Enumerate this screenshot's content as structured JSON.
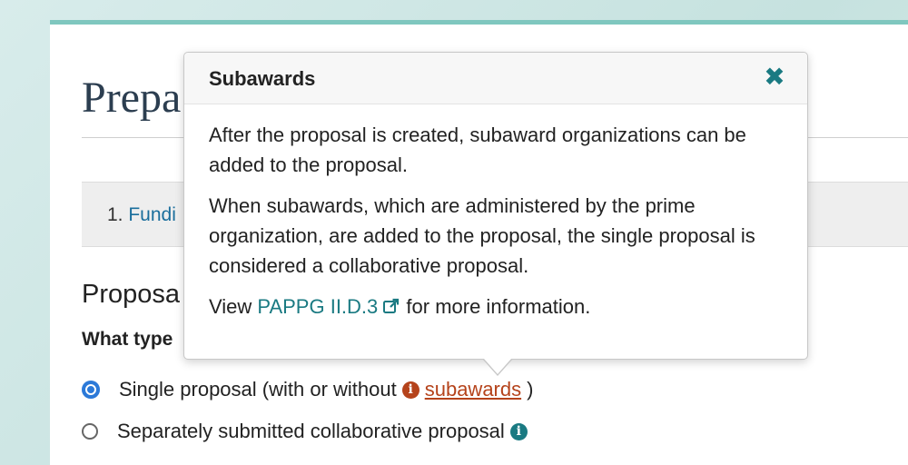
{
  "page": {
    "title": "Prepa",
    "steps": {
      "number": "1.",
      "link": "Fundi"
    },
    "section_heading": "Proposa",
    "question": "What type"
  },
  "options": {
    "single": {
      "label": "Single proposal (with or without",
      "link": "subawards",
      "close_paren": ")",
      "selected": true
    },
    "collaborative": {
      "label": "Separately submitted collaborative proposal",
      "selected": false
    }
  },
  "popover": {
    "title": "Subawards",
    "close_glyph": "✖",
    "paragraph1": "After the proposal is created, subaward organizations can be added to the proposal.",
    "paragraph2": "When subawards, which are administered by the prime organization, are added to the proposal, the single proposal is considered a collaborative proposal.",
    "view_prefix": "View",
    "link_text": "PAPPG II.D.3",
    "view_suffix": "for more information."
  },
  "icons": {
    "info": "info-circle-icon",
    "external": "external-link-icon",
    "close": "close-icon"
  },
  "colors": {
    "accent_teal": "#1a7a82",
    "link_brown": "#b5431b",
    "radio_blue": "#2b79d8",
    "step_link": "#1a6e9c"
  }
}
